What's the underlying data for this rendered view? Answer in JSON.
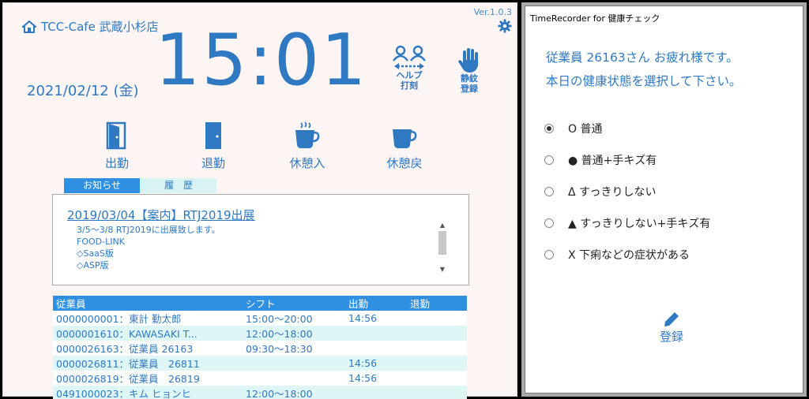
{
  "header": {
    "store_name": "TCC-Cafe 武蔵小杉店",
    "version": "Ver.1.0.3",
    "time": "15:01",
    "date": "2021/02/12 (金)"
  },
  "top_buttons": {
    "help_line1": "ヘルプ",
    "help_line2": "打刻",
    "quiet_line1": "静紋",
    "quiet_line2": "登録"
  },
  "actions": {
    "clock_in": "出勤",
    "clock_out": "退勤",
    "break_in": "休憩入",
    "break_out": "休憩戻"
  },
  "tabs": {
    "notice": "お知らせ",
    "history": "履　歴"
  },
  "notice": {
    "title": "2019/03/04【案内】RTJ2019出展",
    "lines": [
      "3/5～3/8 RTJ2019に出展致します。",
      "FOOD-LINK",
      "◇SaaS版",
      "◇ASP版"
    ]
  },
  "table": {
    "headers": [
      "従業員",
      "シフト",
      "出勤",
      "退勤"
    ],
    "rows": [
      [
        "0000000001：東計 勤太郎",
        "15:00～20:00",
        "14:56",
        ""
      ],
      [
        "0000001610：KAWASAKI T...",
        "12:00～18:00",
        "",
        ""
      ],
      [
        "0000026163：従業員 26163",
        "09:30～18:30",
        "",
        ""
      ],
      [
        "0000026811：従業員　26811",
        "",
        "14:56",
        ""
      ],
      [
        "0000026819：従業員　26819",
        "",
        "14:56",
        ""
      ],
      [
        "0491000023：キム ヒョンヒ",
        "12:00～18:00",
        "",
        ""
      ]
    ]
  },
  "dialog": {
    "title": "TimeRecorder for 健康チェック",
    "greeting_line1": "従業員 26163さん お疲れ様です。",
    "greeting_line2": "本日の健康状態を選択して下さい。",
    "options": [
      "O 普通",
      "● 普通+手キズ有",
      "Δ すっきりしない",
      "▲ すっきりしない+手キズ有",
      "X 下痢などの症状がある"
    ],
    "selected_index": 0,
    "register_label": "登録"
  },
  "colors": {
    "accent": "#2f78c2",
    "header_bg": "#2f8fe0",
    "row_alt": "#dff6f6"
  }
}
